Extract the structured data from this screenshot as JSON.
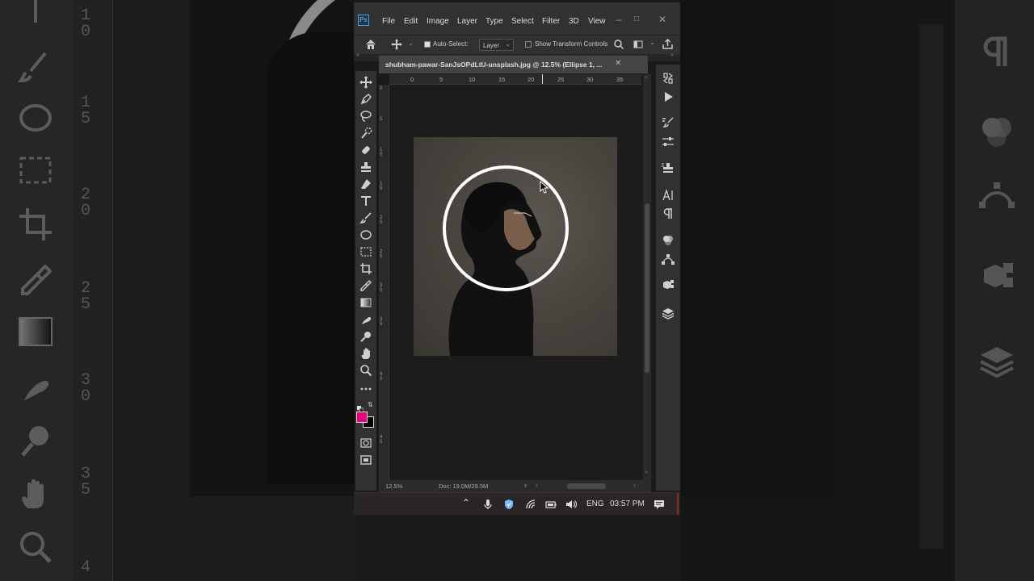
{
  "menu": {
    "app_badge": "Ps",
    "items": [
      "File",
      "Edit",
      "Image",
      "Layer",
      "Type",
      "Select",
      "Filter",
      "3D",
      "View"
    ]
  },
  "options": {
    "auto_select_label": "Auto-Select:",
    "layer_select_value": "Layer",
    "transform_label": "Show Transform Controls"
  },
  "document": {
    "tab_title": "shubham-pawar-SanJsOPdLtU-unsplash.jpg @ 12.5% (Ellipse 1, ..."
  },
  "ruler": {
    "h_labels": [
      "0",
      "5",
      "10",
      "15",
      "20",
      "25",
      "30",
      "35"
    ],
    "v_labels": [
      "0",
      "5",
      "1 0",
      "1 5",
      "2 0",
      "2 5",
      "3 0",
      "3 5",
      "4 0",
      "4 5"
    ]
  },
  "status": {
    "zoom": "12.5%",
    "doc": "Doc: 19.0M/29.5M"
  },
  "taskbar": {
    "language": "ENG",
    "time": "03:57 PM"
  },
  "colors": {
    "foreground": "#e6007e",
    "background": "#000000"
  },
  "background_ruler": [
    "1 0",
    "1 5",
    "2 0",
    "2 5",
    "3 0",
    "3 5",
    "4"
  ]
}
